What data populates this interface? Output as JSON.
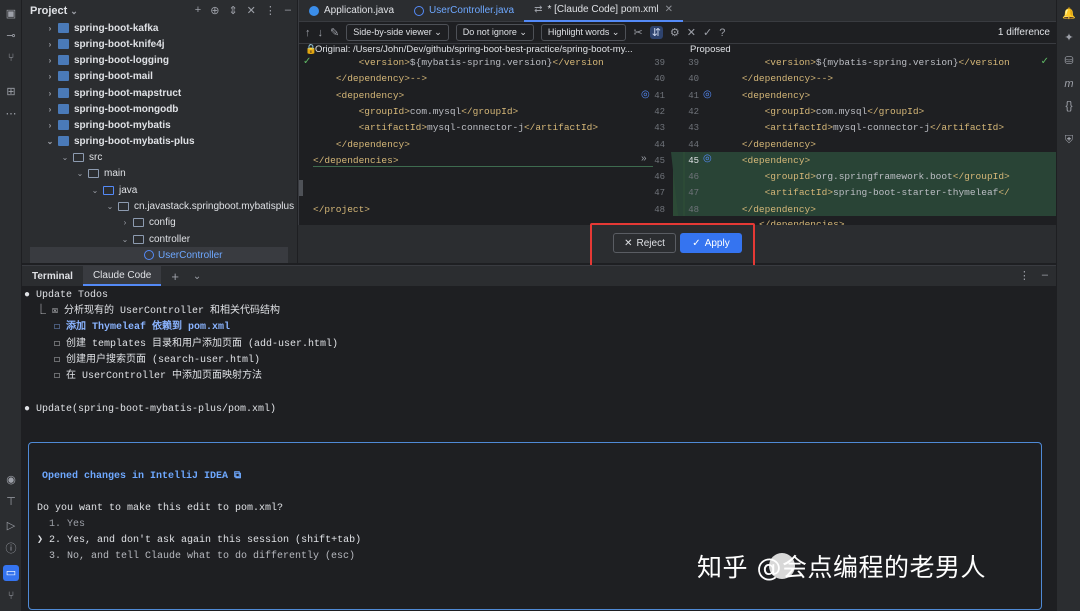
{
  "project": {
    "title": "Project",
    "tree": [
      {
        "label": "spring-boot-kafka"
      },
      {
        "label": "spring-boot-knife4j"
      },
      {
        "label": "spring-boot-logging"
      },
      {
        "label": "spring-boot-mail"
      },
      {
        "label": "spring-boot-mapstruct"
      },
      {
        "label": "spring-boot-mongodb"
      },
      {
        "label": "spring-boot-mybatis"
      },
      {
        "label": "spring-boot-mybatis-plus"
      },
      {
        "label": "src"
      },
      {
        "label": "main"
      },
      {
        "label": "java"
      },
      {
        "label": "cn.javastack.springboot.mybatisplus"
      },
      {
        "label": "config"
      },
      {
        "label": "controller"
      },
      {
        "label": "UserController"
      }
    ]
  },
  "editor": {
    "tabs": [
      {
        "label": "Application.java"
      },
      {
        "label": "UserController.java"
      },
      {
        "label": "* [Claude Code] pom.xml"
      }
    ],
    "toolbar": {
      "viewer": "Side-by-side viewer",
      "ignore": "Do not ignore",
      "highlight": "Highlight words",
      "diff_count": "1 difference"
    },
    "left_header": "Original: /Users/John/Dev/github/spring-boot-best-practice/spring-boot-my...",
    "right_header": "Proposed",
    "left_lines": [
      {
        "text": "        <version>${mybatis-spring.version}</version"
      },
      {
        "text": "    </dependency>-->"
      },
      {
        "text": "    <dependency>"
      },
      {
        "text": "        <groupId>com.mysql</groupId>"
      },
      {
        "text": "        <artifactId>mysql-connector-j</artifactId>"
      },
      {
        "text": "    </dependency>"
      },
      {
        "text": "</dependencies>"
      },
      {
        "text": ""
      },
      {
        "text": ""
      },
      {
        "text": "</project>"
      }
    ],
    "left_numbers": [
      "39",
      "40",
      "41",
      "42",
      "43",
      "44",
      "45",
      "46",
      "47",
      "48"
    ],
    "right_numbers": [
      "39",
      "40",
      "41",
      "42",
      "43",
      "44",
      "45",
      "46",
      "47",
      "48"
    ],
    "right_lines": [
      {
        "text": "        <version>${mybatis-spring.version}</version"
      },
      {
        "text": "    </dependency>-->"
      },
      {
        "text": "    <dependency>"
      },
      {
        "text": "        <groupId>com.mysql</groupId>"
      },
      {
        "text": "        <artifactId>mysql-connector-j</artifactId>"
      },
      {
        "text": "    </dependency>"
      },
      {
        "text": "    <dependency>"
      },
      {
        "text": "        <groupId>org.springframework.boot</groupId>"
      },
      {
        "text": "        <artifactId>spring-boot-starter-thymeleaf</"
      },
      {
        "text": "    </dependency>"
      }
    ],
    "cut_line": "</dependencies>",
    "reject_label": "Reject",
    "apply_label": "Apply"
  },
  "terminal": {
    "tabs": [
      {
        "label": "Terminal"
      },
      {
        "label": "Claude Code"
      }
    ],
    "lines": {
      "update_todos": "● Update Todos",
      "todo1": "  ⎿ ☒ 分析现有的 UserController 和相关代码结构",
      "todo2": "     ☐ 添加 Thymeleaf 依赖到 pom.xml",
      "todo3": "     ☐ 创建 templates 目录和用户添加页面 (add-user.html)",
      "todo4": "     ☐ 创建用户搜索页面 (search-user.html)",
      "todo5": "     ☐ 在 UserController 中添加页面映射方法",
      "update_file": "● Update(spring-boot-mybatis-plus/pom.xml)"
    },
    "prompt": {
      "opened": "Opened changes in IntelliJ IDEA ⧉",
      "question": "Do you want to make this edit to pom.xml?",
      "opt1": "  1. Yes",
      "opt2": "❯ 2. Yes, and don't ask again this session (shift+tab)",
      "opt3": "  3. No, and tell Claude what to do differently (esc)"
    }
  },
  "watermark": "知乎 @会点编程的老男人"
}
